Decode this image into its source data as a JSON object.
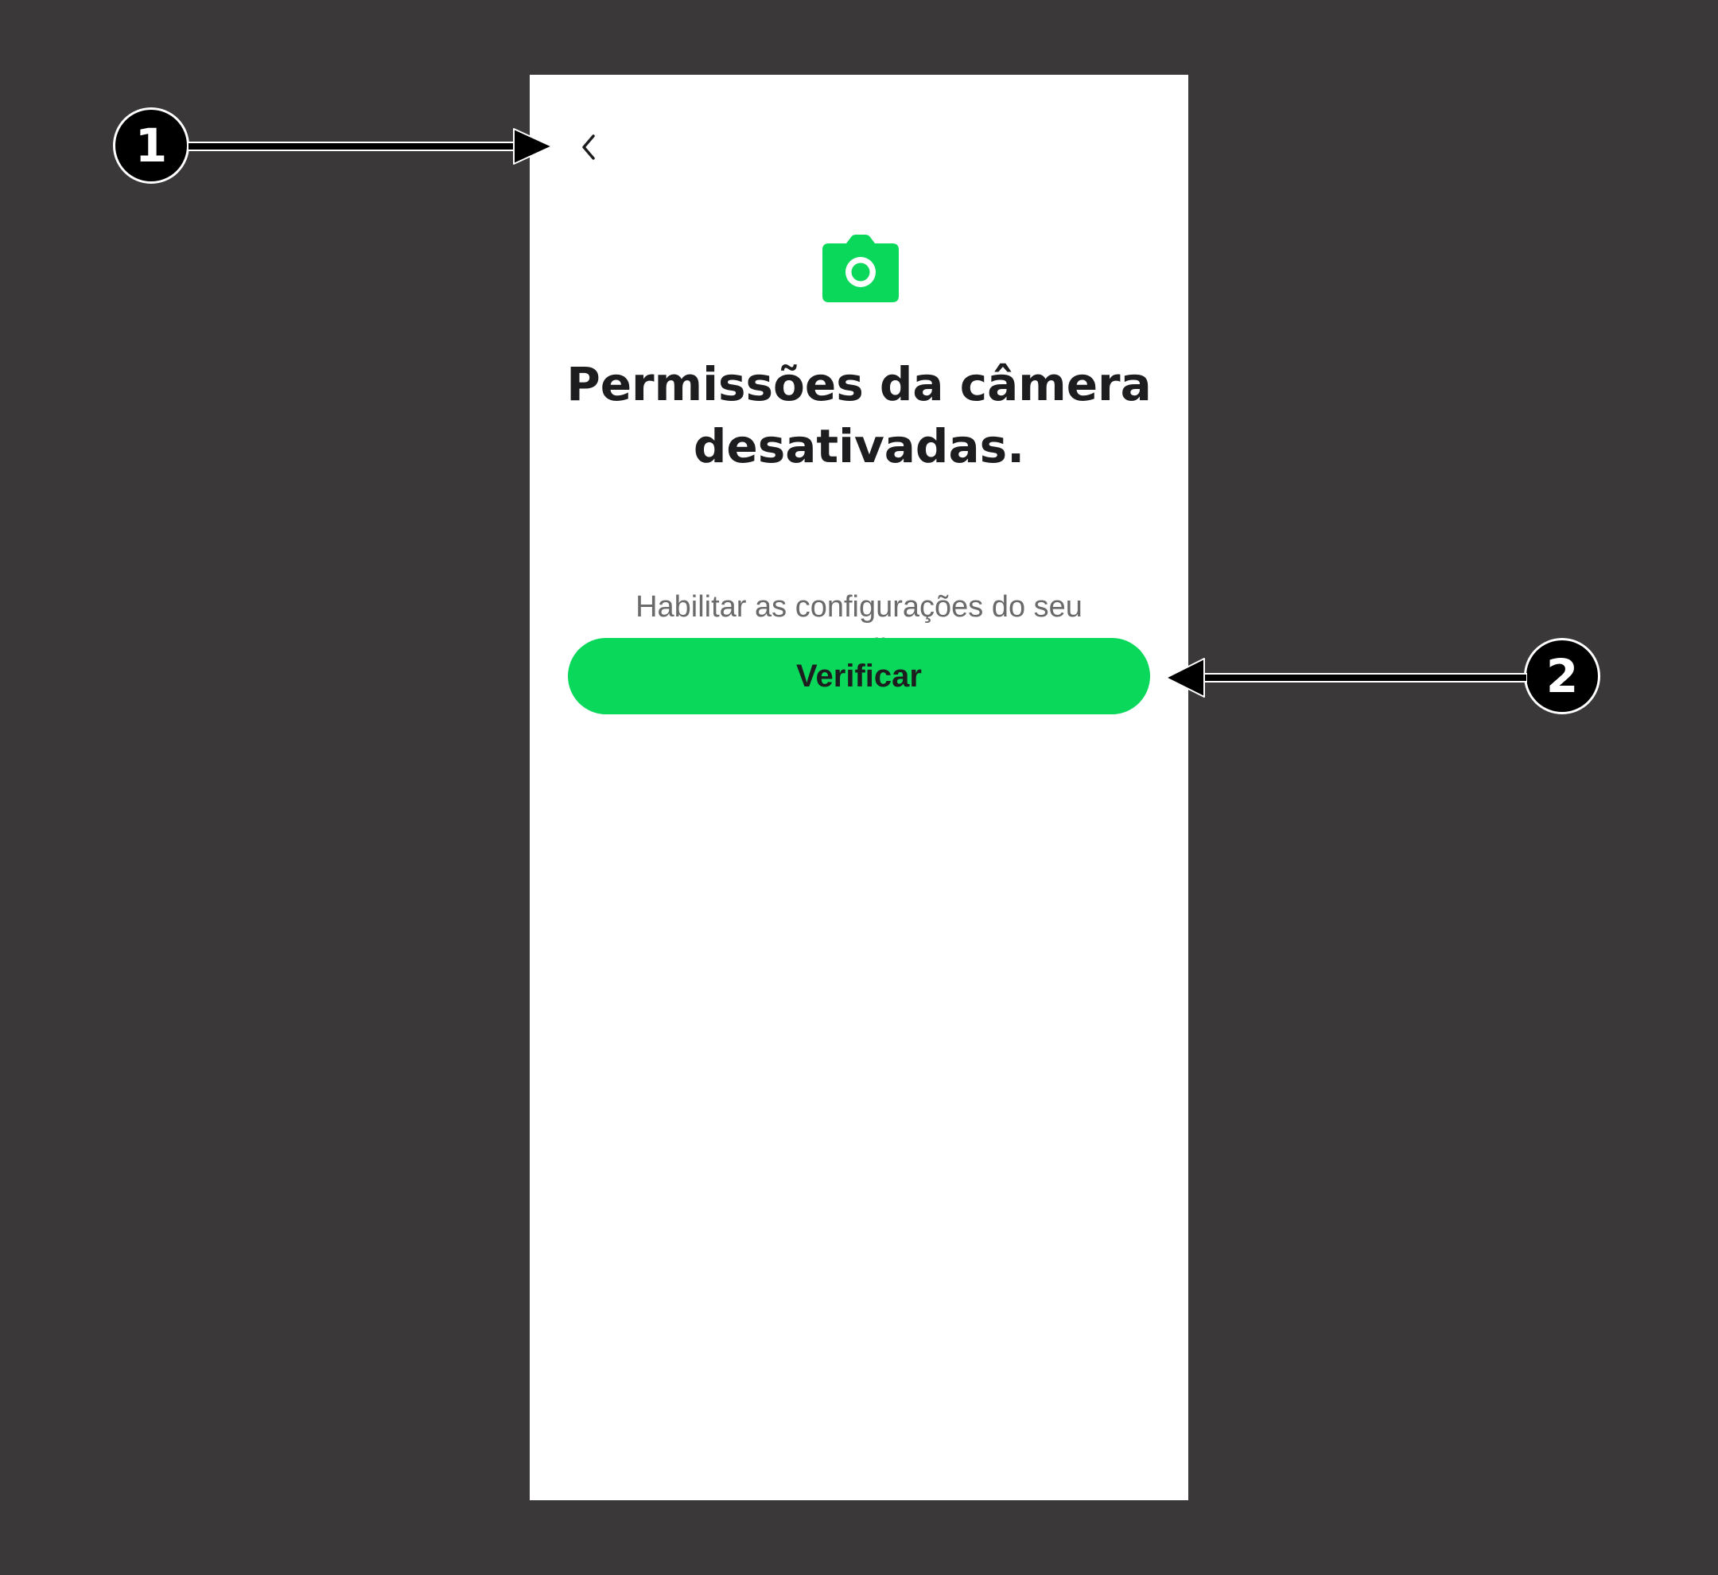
{
  "screen": {
    "title": "Permissões da câmera desativadas.",
    "subtitle": "Habilitar as configurações do seu aparelho.",
    "primary_button_label": "Verificar",
    "back_icon": "chevron-left-icon",
    "hero_icon": "camera-icon"
  },
  "annotations": [
    {
      "number": "1"
    },
    {
      "number": "2"
    }
  ],
  "colors": {
    "background": "#3a3839",
    "screen": "#ffffff",
    "accent": "#0ad85b",
    "title_text": "#1d1d1f",
    "subtitle_text": "#6a6a6a"
  }
}
